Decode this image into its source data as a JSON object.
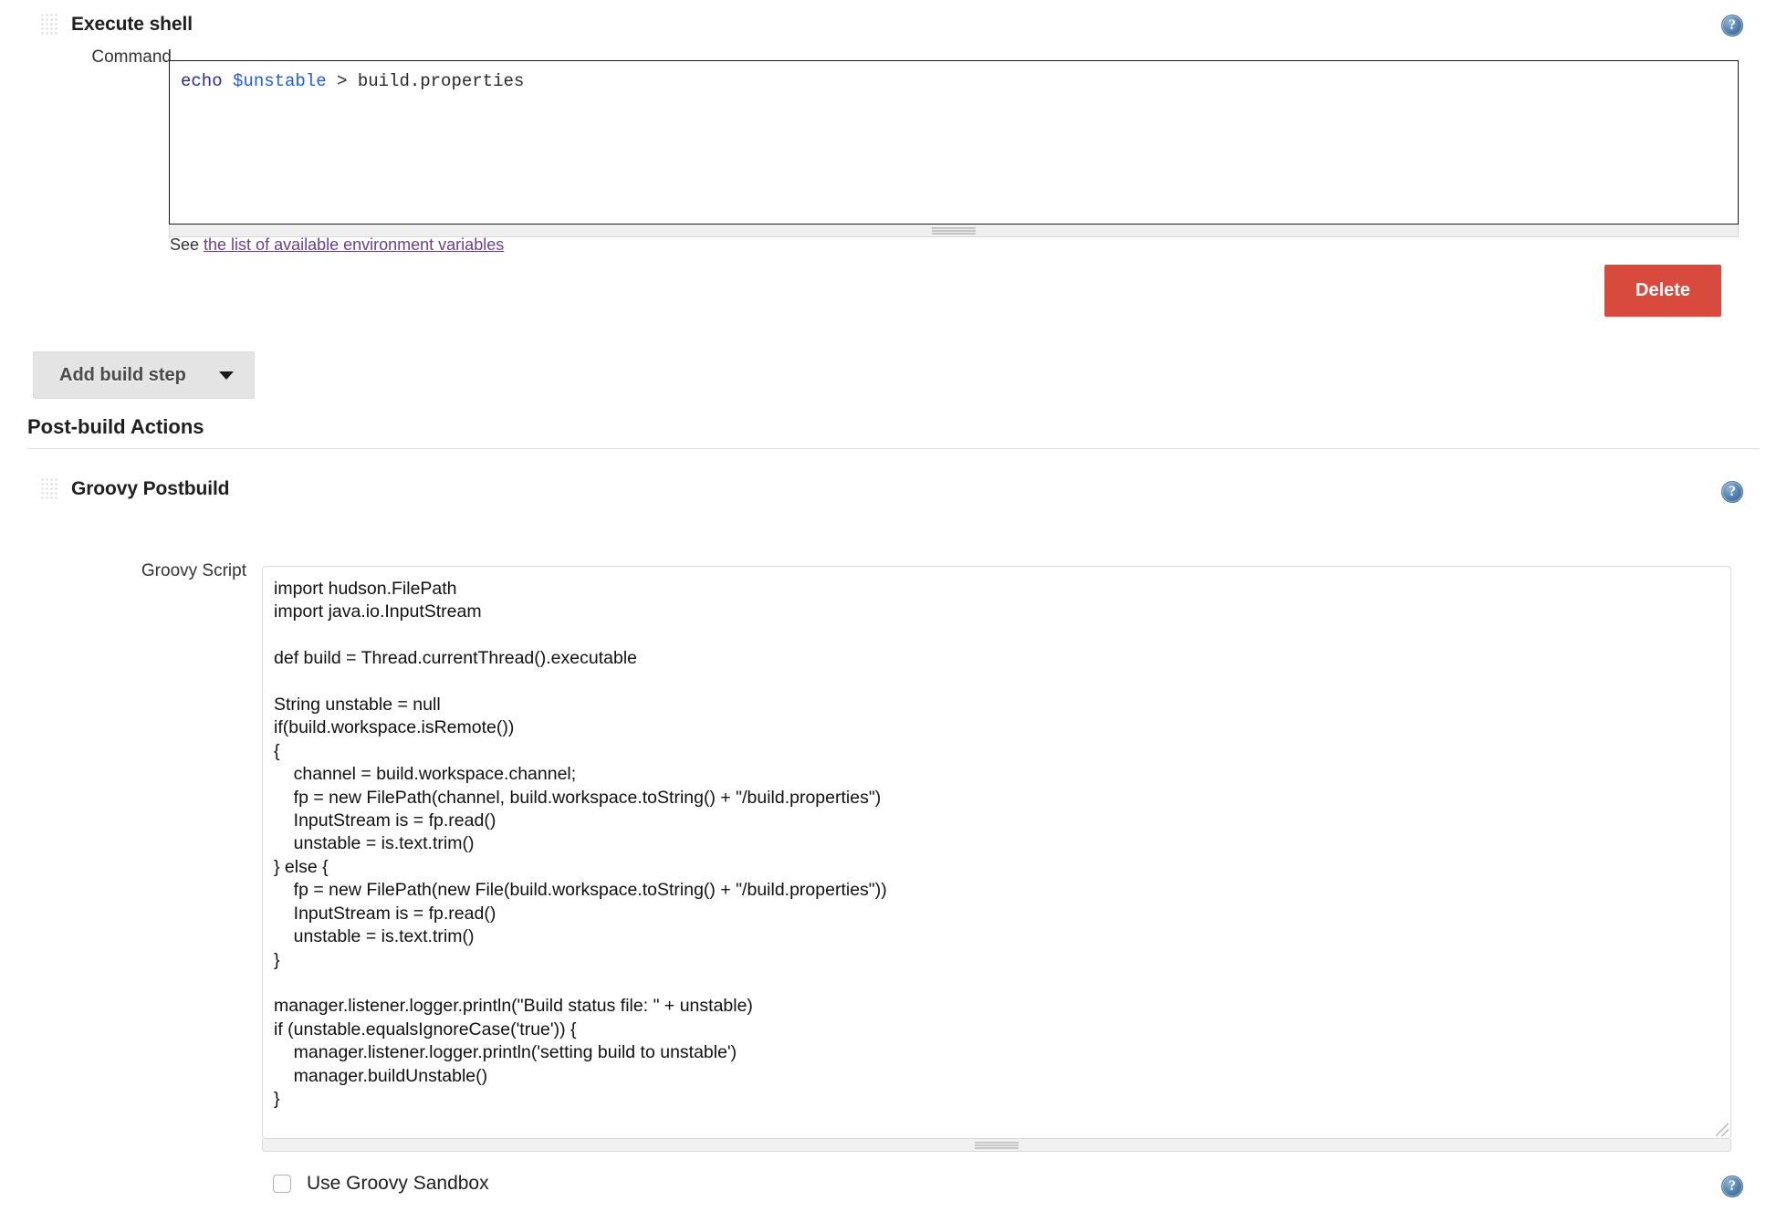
{
  "build_step": {
    "title": "Execute shell",
    "drag_handle": "drag-handle-icon",
    "help": "?",
    "command_label": "Command",
    "command_value_tokens": {
      "keyword": "echo",
      "variable": "$unstable",
      "rest": " > build.properties"
    },
    "command_value": "echo $unstable > build.properties",
    "see_prefix": "See ",
    "see_link": "the list of available environment variables",
    "delete_label": "Delete"
  },
  "add_build_step": {
    "label": "Add build step",
    "caret": "chevron-down-icon"
  },
  "post_build": {
    "heading": "Post-build Actions",
    "groovy": {
      "title": "Groovy Postbuild",
      "help": "?",
      "script_label": "Groovy Script",
      "script_value": "import hudson.FilePath\nimport java.io.InputStream\n\ndef build = Thread.currentThread().executable\n\nString unstable = null\nif(build.workspace.isRemote())\n{\n    channel = build.workspace.channel;\n    fp = new FilePath(channel, build.workspace.toString() + \"/build.properties\")\n    InputStream is = fp.read()\n    unstable = is.text.trim()\n} else {\n    fp = new FilePath(new File(build.workspace.toString() + \"/build.properties\"))\n    InputStream is = fp.read()\n    unstable = is.text.trim()\n}\n\nmanager.listener.logger.println(\"Build status file: \" + unstable)\nif (unstable.equalsIgnoreCase('true')) {\n    manager.listener.logger.println('setting build to unstable')\n    manager.buildUnstable()\n}",
      "sandbox_label": "Use Groovy Sandbox",
      "sandbox_checked": false,
      "sandbox_help": "?"
    }
  },
  "colors": {
    "delete_red": "#d74a3c",
    "link_purple": "#6b3f8f",
    "keyword_blue": "#2b2b8f",
    "variable_blue": "#1f5bef",
    "button_gray": "#e4e4e4",
    "help_blue": "#5b87b5"
  }
}
